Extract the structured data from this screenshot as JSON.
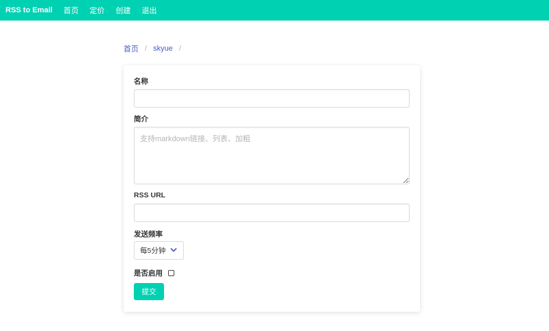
{
  "navbar": {
    "brand": "RSS to Email",
    "items": [
      "首页",
      "定价",
      "创建",
      "退出"
    ]
  },
  "breadcrumb": {
    "items": [
      "首页",
      "skyue"
    ],
    "separator": "/"
  },
  "form": {
    "name_label": "名称",
    "name_value": "",
    "intro_label": "简介",
    "intro_placeholder": "支持markdown链接、列表、加粗",
    "rss_label": "RSS URL",
    "rss_value": "",
    "freq_label": "发送频率",
    "freq_selected": "每5分钟",
    "enabled_label": "是否启用",
    "enabled_checked": false,
    "submit_label": "提交"
  },
  "colors": {
    "primary": "#00d1b2",
    "link": "#485fc7"
  }
}
